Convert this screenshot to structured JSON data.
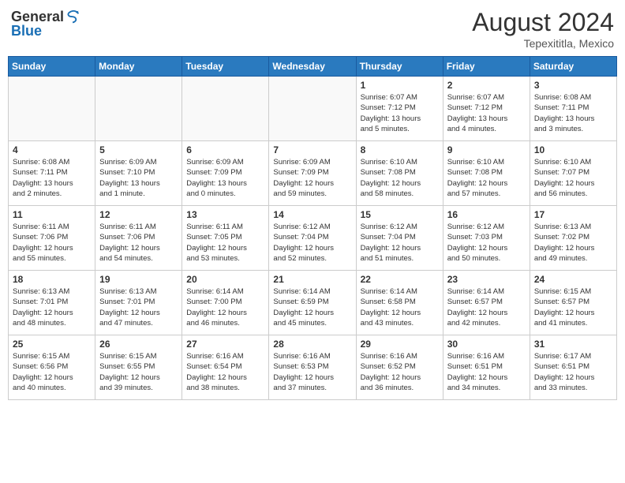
{
  "header": {
    "logo_general": "General",
    "logo_blue": "Blue",
    "month_year": "August 2024",
    "location": "Tepexititla, Mexico"
  },
  "days_of_week": [
    "Sunday",
    "Monday",
    "Tuesday",
    "Wednesday",
    "Thursday",
    "Friday",
    "Saturday"
  ],
  "weeks": [
    [
      {
        "day": "",
        "info": ""
      },
      {
        "day": "",
        "info": ""
      },
      {
        "day": "",
        "info": ""
      },
      {
        "day": "",
        "info": ""
      },
      {
        "day": "1",
        "info": "Sunrise: 6:07 AM\nSunset: 7:12 PM\nDaylight: 13 hours\nand 5 minutes."
      },
      {
        "day": "2",
        "info": "Sunrise: 6:07 AM\nSunset: 7:12 PM\nDaylight: 13 hours\nand 4 minutes."
      },
      {
        "day": "3",
        "info": "Sunrise: 6:08 AM\nSunset: 7:11 PM\nDaylight: 13 hours\nand 3 minutes."
      }
    ],
    [
      {
        "day": "4",
        "info": "Sunrise: 6:08 AM\nSunset: 7:11 PM\nDaylight: 13 hours\nand 2 minutes."
      },
      {
        "day": "5",
        "info": "Sunrise: 6:09 AM\nSunset: 7:10 PM\nDaylight: 13 hours\nand 1 minute."
      },
      {
        "day": "6",
        "info": "Sunrise: 6:09 AM\nSunset: 7:09 PM\nDaylight: 13 hours\nand 0 minutes."
      },
      {
        "day": "7",
        "info": "Sunrise: 6:09 AM\nSunset: 7:09 PM\nDaylight: 12 hours\nand 59 minutes."
      },
      {
        "day": "8",
        "info": "Sunrise: 6:10 AM\nSunset: 7:08 PM\nDaylight: 12 hours\nand 58 minutes."
      },
      {
        "day": "9",
        "info": "Sunrise: 6:10 AM\nSunset: 7:08 PM\nDaylight: 12 hours\nand 57 minutes."
      },
      {
        "day": "10",
        "info": "Sunrise: 6:10 AM\nSunset: 7:07 PM\nDaylight: 12 hours\nand 56 minutes."
      }
    ],
    [
      {
        "day": "11",
        "info": "Sunrise: 6:11 AM\nSunset: 7:06 PM\nDaylight: 12 hours\nand 55 minutes."
      },
      {
        "day": "12",
        "info": "Sunrise: 6:11 AM\nSunset: 7:06 PM\nDaylight: 12 hours\nand 54 minutes."
      },
      {
        "day": "13",
        "info": "Sunrise: 6:11 AM\nSunset: 7:05 PM\nDaylight: 12 hours\nand 53 minutes."
      },
      {
        "day": "14",
        "info": "Sunrise: 6:12 AM\nSunset: 7:04 PM\nDaylight: 12 hours\nand 52 minutes."
      },
      {
        "day": "15",
        "info": "Sunrise: 6:12 AM\nSunset: 7:04 PM\nDaylight: 12 hours\nand 51 minutes."
      },
      {
        "day": "16",
        "info": "Sunrise: 6:12 AM\nSunset: 7:03 PM\nDaylight: 12 hours\nand 50 minutes."
      },
      {
        "day": "17",
        "info": "Sunrise: 6:13 AM\nSunset: 7:02 PM\nDaylight: 12 hours\nand 49 minutes."
      }
    ],
    [
      {
        "day": "18",
        "info": "Sunrise: 6:13 AM\nSunset: 7:01 PM\nDaylight: 12 hours\nand 48 minutes."
      },
      {
        "day": "19",
        "info": "Sunrise: 6:13 AM\nSunset: 7:01 PM\nDaylight: 12 hours\nand 47 minutes."
      },
      {
        "day": "20",
        "info": "Sunrise: 6:14 AM\nSunset: 7:00 PM\nDaylight: 12 hours\nand 46 minutes."
      },
      {
        "day": "21",
        "info": "Sunrise: 6:14 AM\nSunset: 6:59 PM\nDaylight: 12 hours\nand 45 minutes."
      },
      {
        "day": "22",
        "info": "Sunrise: 6:14 AM\nSunset: 6:58 PM\nDaylight: 12 hours\nand 43 minutes."
      },
      {
        "day": "23",
        "info": "Sunrise: 6:14 AM\nSunset: 6:57 PM\nDaylight: 12 hours\nand 42 minutes."
      },
      {
        "day": "24",
        "info": "Sunrise: 6:15 AM\nSunset: 6:57 PM\nDaylight: 12 hours\nand 41 minutes."
      }
    ],
    [
      {
        "day": "25",
        "info": "Sunrise: 6:15 AM\nSunset: 6:56 PM\nDaylight: 12 hours\nand 40 minutes."
      },
      {
        "day": "26",
        "info": "Sunrise: 6:15 AM\nSunset: 6:55 PM\nDaylight: 12 hours\nand 39 minutes."
      },
      {
        "day": "27",
        "info": "Sunrise: 6:16 AM\nSunset: 6:54 PM\nDaylight: 12 hours\nand 38 minutes."
      },
      {
        "day": "28",
        "info": "Sunrise: 6:16 AM\nSunset: 6:53 PM\nDaylight: 12 hours\nand 37 minutes."
      },
      {
        "day": "29",
        "info": "Sunrise: 6:16 AM\nSunset: 6:52 PM\nDaylight: 12 hours\nand 36 minutes."
      },
      {
        "day": "30",
        "info": "Sunrise: 6:16 AM\nSunset: 6:51 PM\nDaylight: 12 hours\nand 34 minutes."
      },
      {
        "day": "31",
        "info": "Sunrise: 6:17 AM\nSunset: 6:51 PM\nDaylight: 12 hours\nand 33 minutes."
      }
    ]
  ]
}
